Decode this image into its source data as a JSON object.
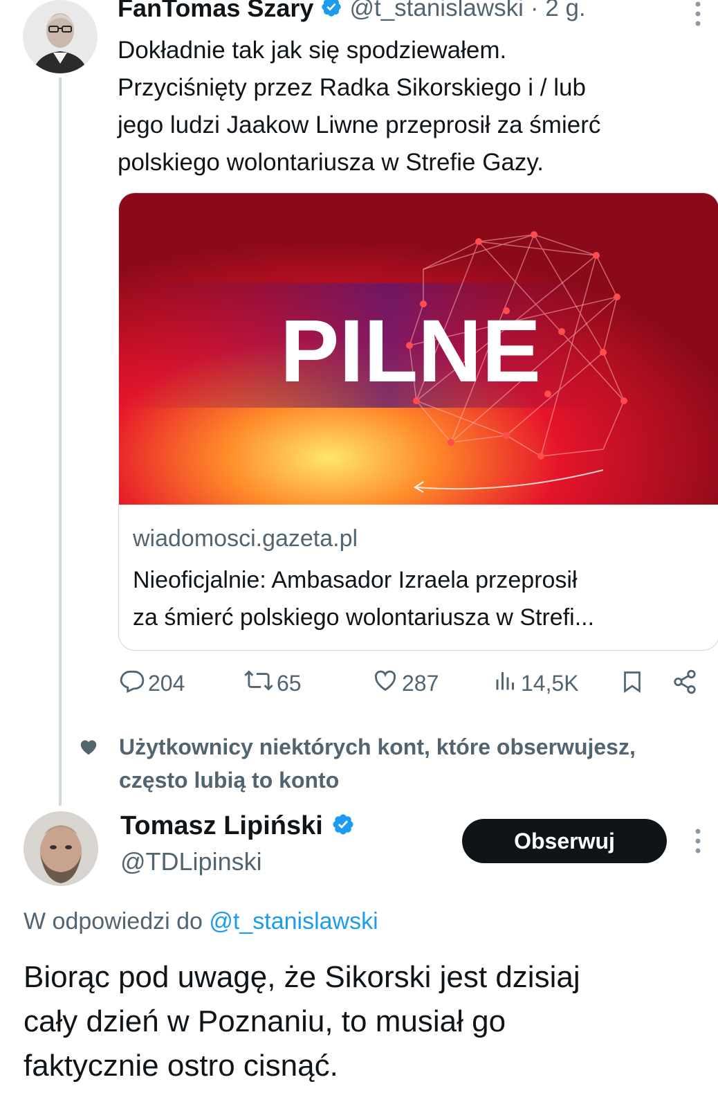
{
  "tweet1": {
    "author_name": "FanTomas Szary",
    "handle": "@t_stanislawski",
    "time": "· 2 g.",
    "text_lines": [
      "Dokładnie tak jak się spodziewałem.",
      "Przyciśnięty przez Radka Sikorskiego i / lub",
      "jego ludzi Jaakow Liwne przeprosił za śmierć",
      "polskiego wolontariusza w Strefie Gazy."
    ],
    "card": {
      "image_text": "PILNE",
      "domain": "wiadomosci.gazeta.pl",
      "title_line1": "Nieoficjalnie: Ambasador Izraela przeprosił",
      "title_line2": "za śmierć polskiego wolontariusza w Strefi..."
    },
    "actions": {
      "replies": "204",
      "reposts": "65",
      "likes": "287",
      "views": "14,5K"
    }
  },
  "social_context": {
    "line1": "Użytkownicy niektórych kont, które obserwujesz,",
    "line2": "często lubią to konto"
  },
  "tweet2": {
    "author_name": "Tomasz Lipiński",
    "handle": "@TDLipinski",
    "follow_label": "Obserwuj",
    "reply_prefix": "W odpowiedzi do",
    "reply_handle": "@t_stanislawski",
    "text_lines": [
      "Biorąc pod uwagę, że Sikorski jest dzisiaj",
      "cały dzień w Poznaniu, to musiał go",
      "faktycznie ostro cisnąć."
    ]
  },
  "colors": {
    "verified": "#1d9bf0",
    "muted": "#536471",
    "link": "#1d9bf0",
    "button": "#0f1419"
  }
}
